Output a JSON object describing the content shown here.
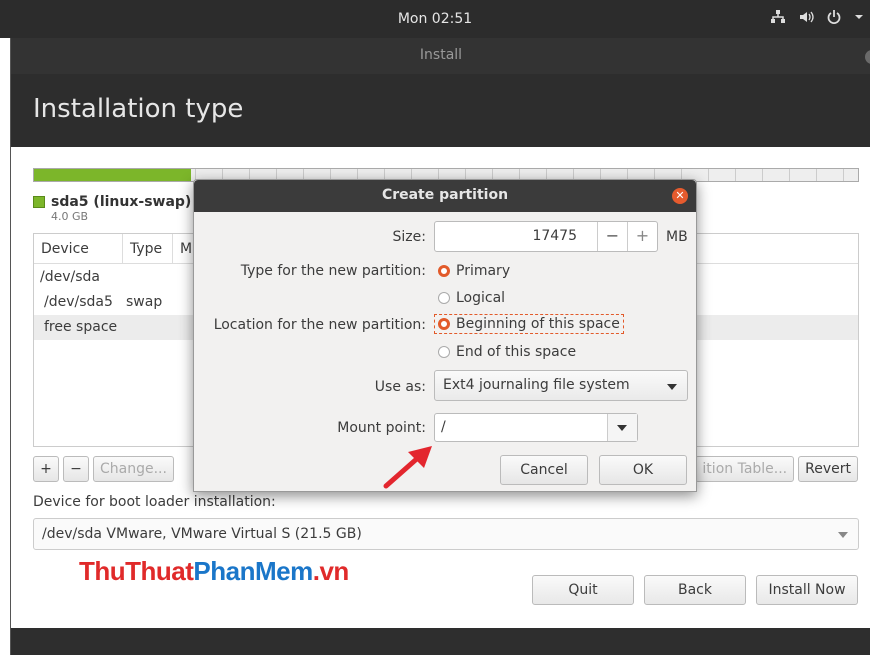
{
  "top_panel": {
    "clock": "Mon 02:51"
  },
  "window": {
    "title": "Install",
    "header": "Installation type"
  },
  "partition_bar": {
    "legend_label": "sda5 (linux-swap)",
    "legend_size": "4.0 GB",
    "swap_fraction": 0.19,
    "swap_color": "#7cb62a"
  },
  "table": {
    "columns": [
      "Device",
      "Type",
      "M"
    ],
    "rows": [
      {
        "device": "/dev/sda",
        "type": ""
      },
      {
        "device": "/dev/sda5",
        "type": "swap"
      },
      {
        "device": "free space",
        "type": ""
      }
    ],
    "buttons": {
      "add": "+",
      "remove": "−",
      "change": "Change...",
      "new_table": "ition Table...",
      "revert": "Revert"
    }
  },
  "boot": {
    "label": "Device for boot loader installation:",
    "value": "/dev/sda VMware, VMware Virtual S (21.5 GB)"
  },
  "watermark": {
    "part1": "ThuThuat",
    "part2": "PhanMem",
    "part3": ".vn"
  },
  "footer_buttons": {
    "quit": "Quit",
    "back": "Back",
    "install": "Install Now"
  },
  "dialog": {
    "title": "Create partition",
    "size_label": "Size:",
    "size_value": "17475",
    "size_minus": "−",
    "size_plus": "+",
    "size_unit": "MB",
    "type_label": "Type for the new partition:",
    "type_options": [
      "Primary",
      "Logical"
    ],
    "type_selected": "Primary",
    "location_label": "Location for the new partition:",
    "location_options": [
      "Beginning of this space",
      "End of this space"
    ],
    "location_selected": "Beginning of this space",
    "useas_label": "Use as:",
    "useas_value": "Ext4 journaling file system",
    "mount_label": "Mount point:",
    "mount_value": "/",
    "cancel": "Cancel",
    "ok": "OK",
    "accent_color": "#e25a2a"
  }
}
